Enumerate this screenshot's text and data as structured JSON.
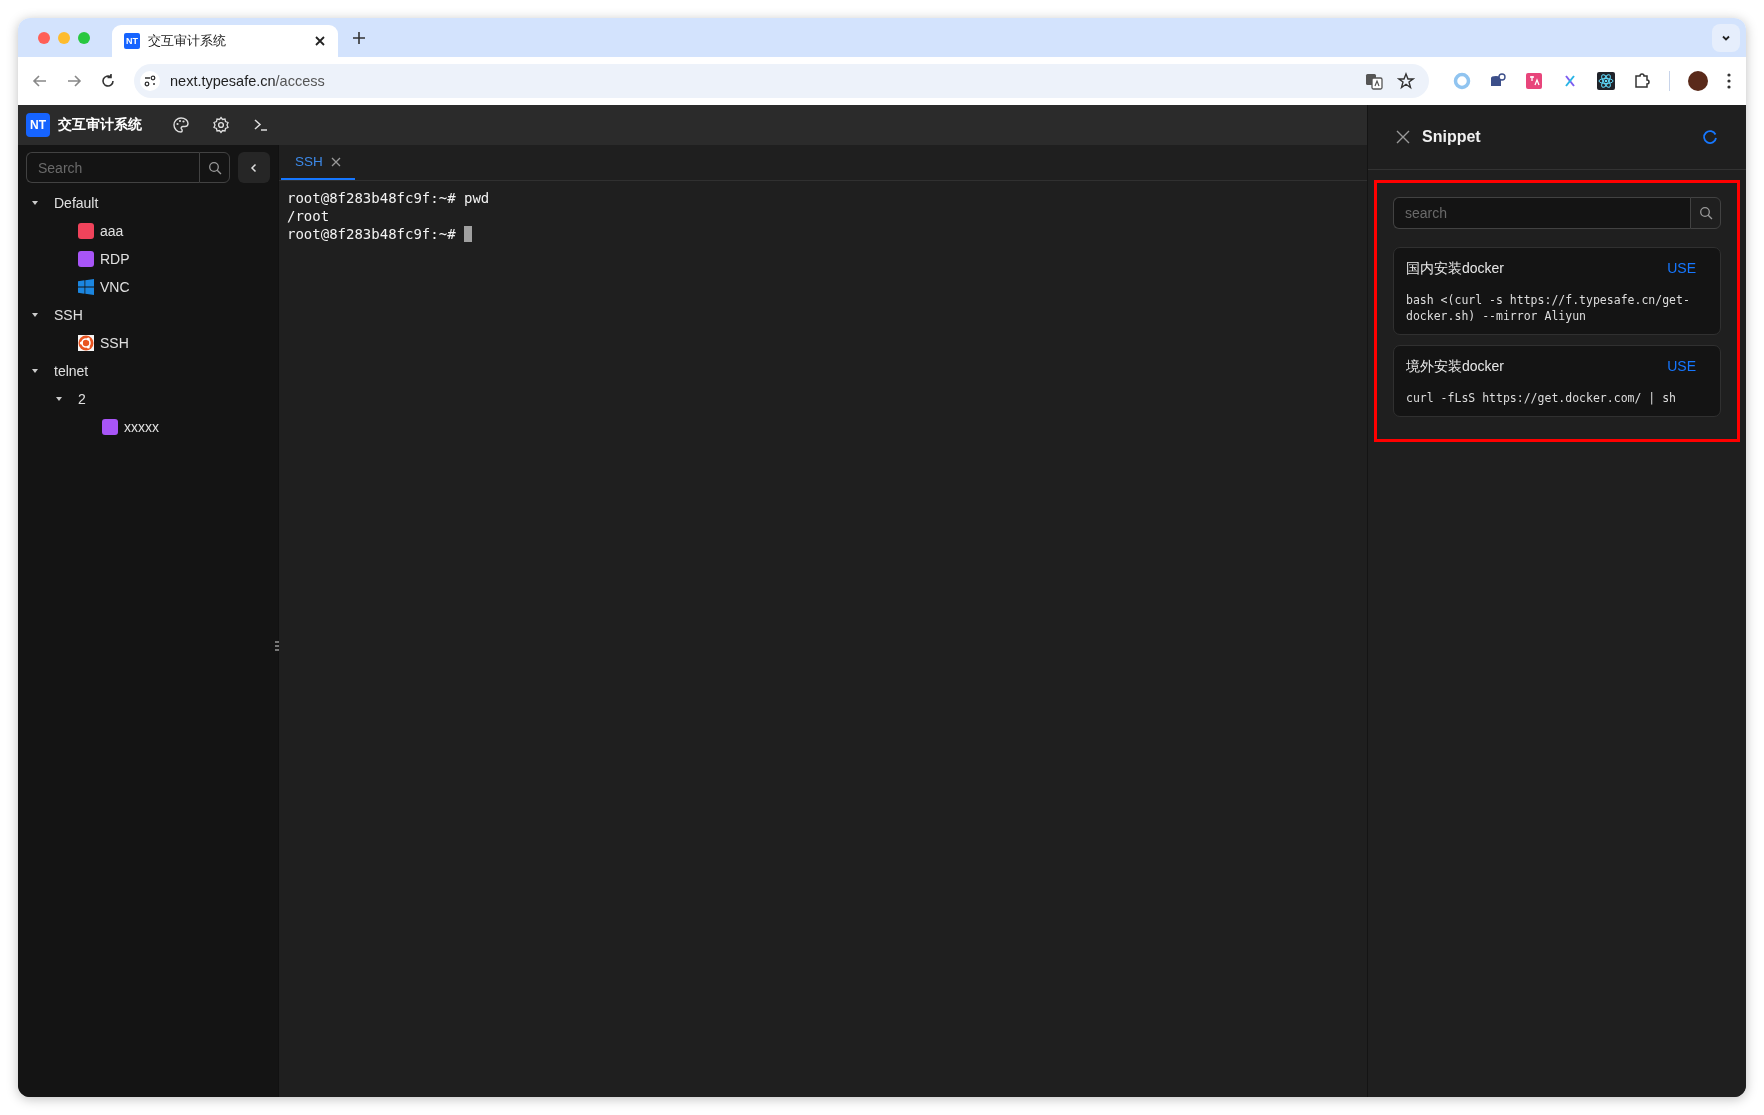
{
  "browser": {
    "tabs": [
      {
        "title": "交互审计系统",
        "favicon": "NT",
        "selected": true
      }
    ],
    "url_host": "next.typesafe.cn",
    "url_path": "/access"
  },
  "app": {
    "logo": "NT",
    "title": "交互审计系统"
  },
  "sidebar": {
    "search": {
      "placeholder": "Search"
    },
    "tree": [
      {
        "label": "Default",
        "kind": "group",
        "expanded": true,
        "children": [
          {
            "label": "aaa",
            "kind": "color-host",
            "color": "#f0435b"
          },
          {
            "label": "RDP",
            "kind": "color-host",
            "color": "#a855f7"
          },
          {
            "label": "VNC",
            "kind": "windows-host"
          }
        ]
      },
      {
        "label": "SSH",
        "kind": "group",
        "expanded": true,
        "children": [
          {
            "label": "SSH",
            "kind": "ubuntu-host"
          }
        ]
      },
      {
        "label": "telnet",
        "kind": "group",
        "expanded": true,
        "children": [
          {
            "label": "2",
            "kind": "group",
            "expanded": true,
            "children": [
              {
                "label": "xxxxx",
                "kind": "color-host",
                "color": "#a855f7"
              }
            ]
          }
        ]
      }
    ]
  },
  "terminal": {
    "tabs": [
      {
        "label": "SSH",
        "selected": true
      }
    ],
    "lines": [
      {
        "text": "root@8f283b48fc9f:~# pwd"
      },
      {
        "text": "/root"
      },
      {
        "text": "root@8f283b48fc9f:~# "
      }
    ],
    "cursor": true
  },
  "snippet_panel": {
    "title": "Snippet",
    "highlighted": true,
    "search": {
      "placeholder": "search"
    },
    "snippets": [
      {
        "name": "国内安装docker",
        "action": "USE",
        "command": "bash <(curl -s https://f.typesafe.cn/get-docker.sh) --mirror Aliyun"
      },
      {
        "name": "境外安装docker",
        "action": "USE",
        "command": "curl -fLsS https://get.docker.com/ | sh"
      }
    ]
  }
}
